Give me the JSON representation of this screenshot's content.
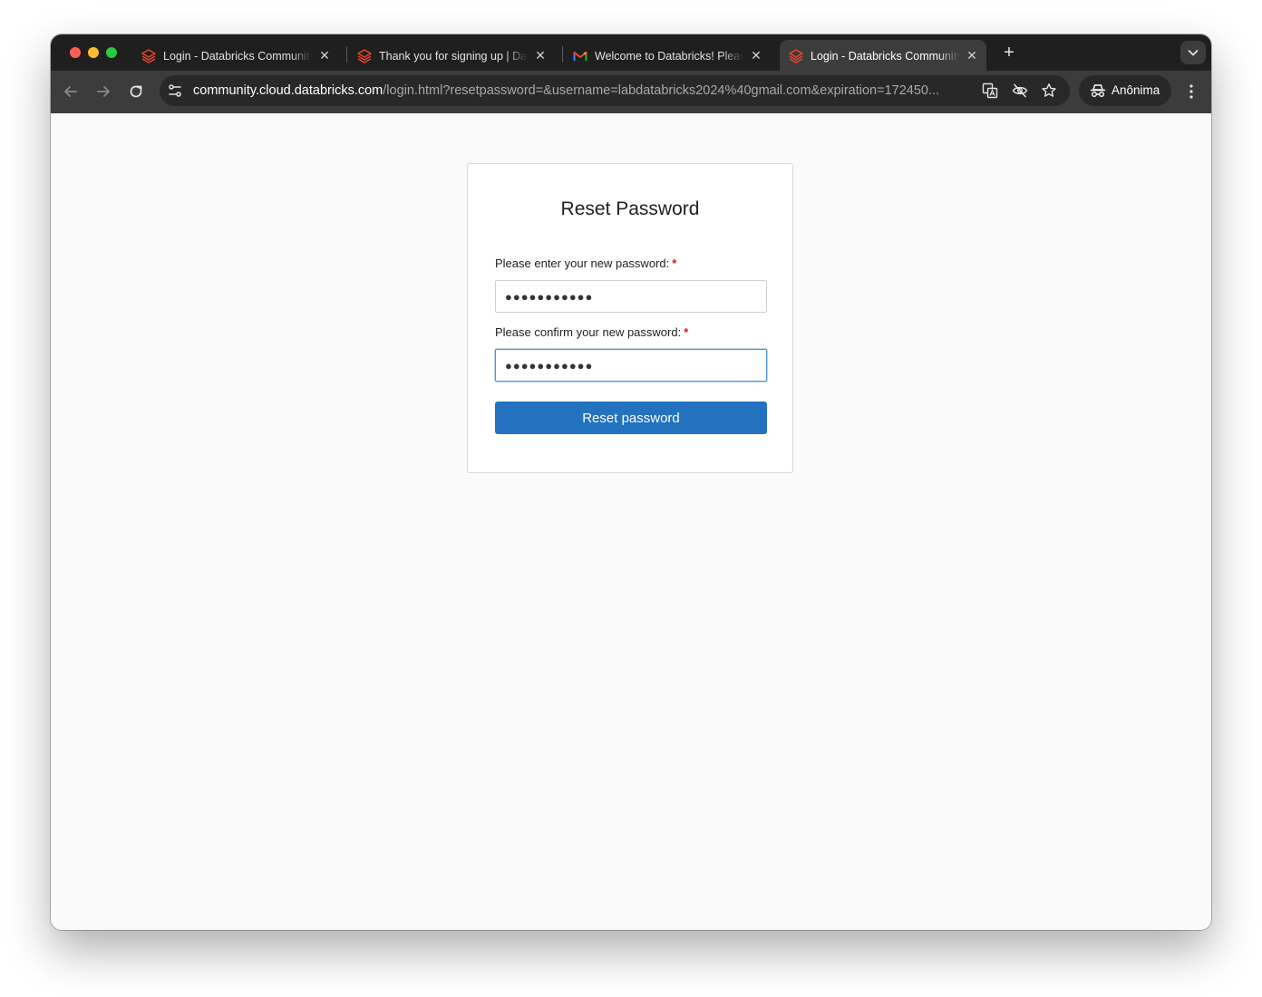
{
  "browser": {
    "tabs": [
      {
        "title": "Login - Databricks Community Edition",
        "favicon": "databricks-icon",
        "active": false
      },
      {
        "title": "Thank you for signing up | Databricks",
        "favicon": "databricks-icon",
        "active": false
      },
      {
        "title": "Welcome to Databricks! Please verify your email address",
        "favicon": "gmail-icon",
        "active": false
      },
      {
        "title": "Login - Databricks Community Edition",
        "favicon": "databricks-icon",
        "active": true
      }
    ],
    "url": {
      "host": "community.cloud.databricks.com",
      "path": "/login.html?resetpassword=&username=labdatabricks2024%40gmail.com&expiration=172450..."
    },
    "profile_label": "Anônima"
  },
  "form": {
    "title": "Reset Password",
    "new_password_label": "Please enter your new password:",
    "confirm_password_label": "Please confirm your new password:",
    "required_marker": "*",
    "new_password_value": "●●●●●●●●●●●",
    "confirm_password_value": "●●●●●●●●●●●",
    "submit_label": "Reset password"
  },
  "colors": {
    "accent": "#2272bf",
    "focus": "#4a90d9",
    "required": "#d01919",
    "databricks": "#e8452c"
  }
}
